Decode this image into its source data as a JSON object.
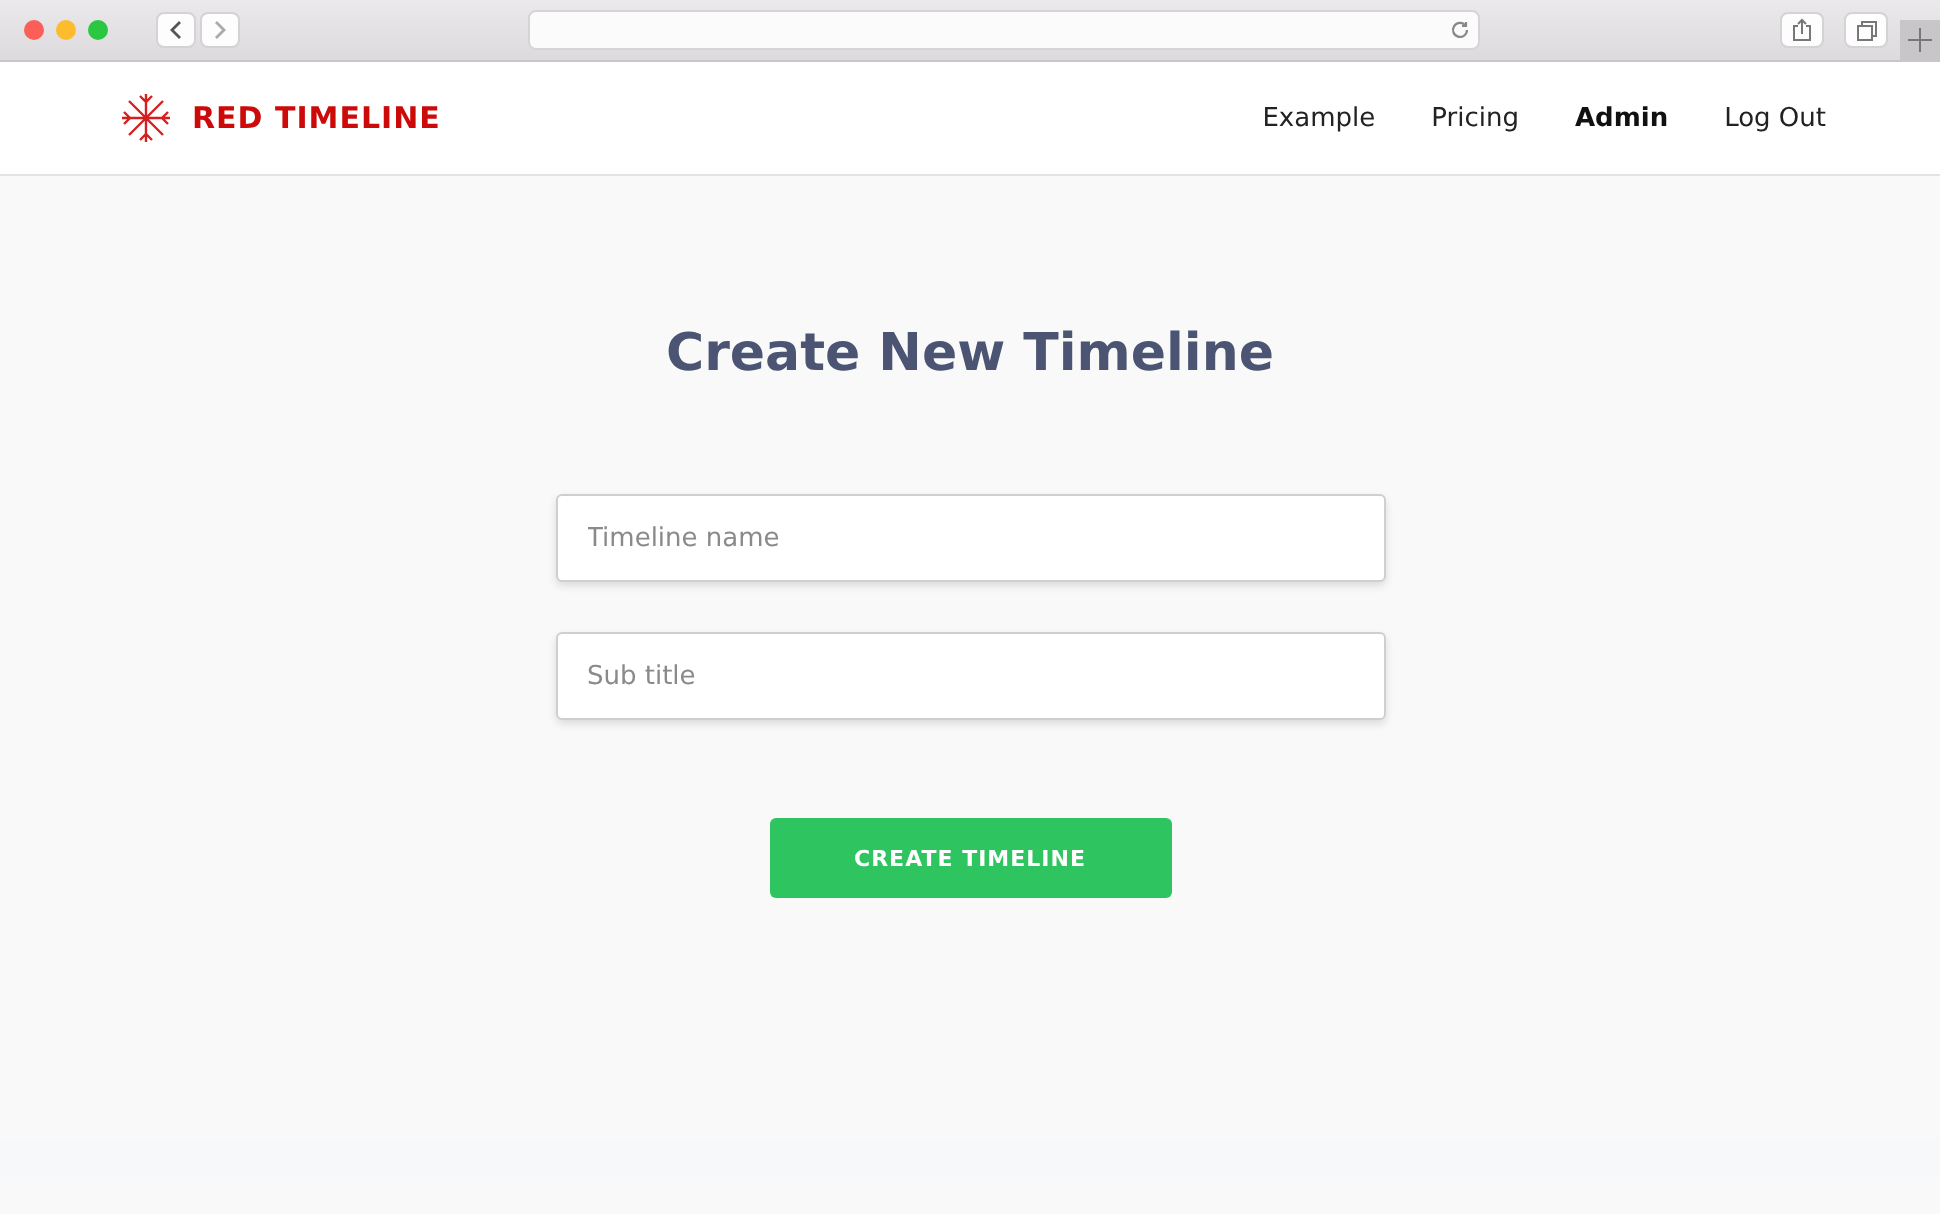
{
  "brand": {
    "name": "RED TIMELINE"
  },
  "nav": [
    {
      "label": "Example",
      "selected": false
    },
    {
      "label": "Pricing",
      "selected": false
    },
    {
      "label": "Admin",
      "selected": true
    },
    {
      "label": "Log Out",
      "selected": false
    }
  ],
  "form": {
    "title": "Create New Timeline",
    "fields": [
      {
        "placeholder": "Timeline name"
      },
      {
        "placeholder": "Sub title"
      }
    ],
    "submit": "CREATE TIMELINE"
  }
}
